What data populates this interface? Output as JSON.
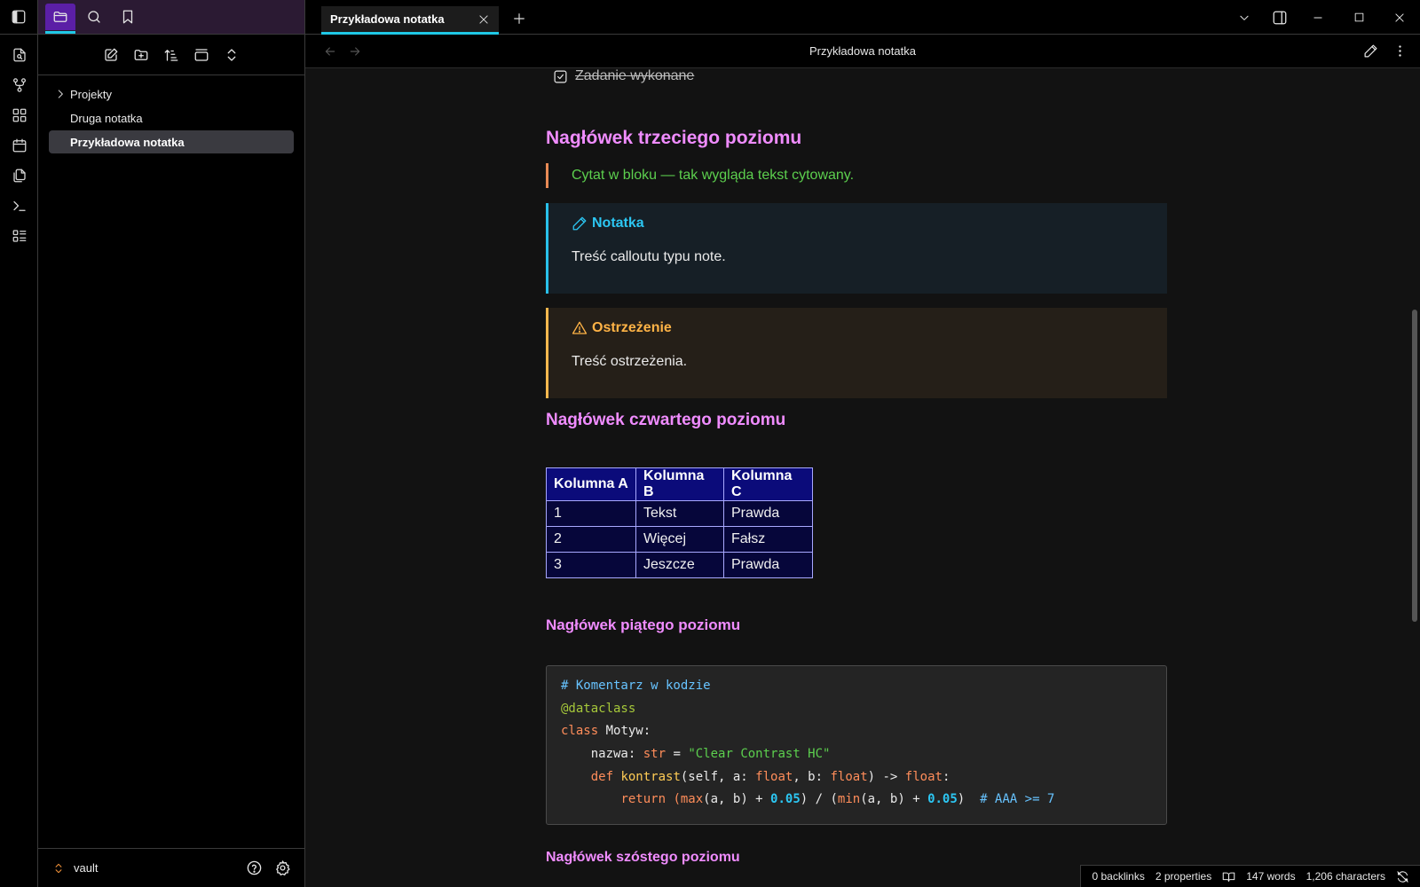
{
  "sidebar": {
    "tabs": [
      {
        "icon": "folder-icon",
        "active": true
      },
      {
        "icon": "search-icon",
        "active": false
      },
      {
        "icon": "bookmark-icon",
        "active": false
      }
    ],
    "tree": [
      {
        "label": "Projekty",
        "type": "folder",
        "collapsed": true
      },
      {
        "label": "Druga notatka",
        "type": "file"
      },
      {
        "label": "Przykładowa notatka",
        "type": "file",
        "active": true
      }
    ],
    "vault_name": "vault"
  },
  "tab": {
    "title": "Przykładowa notatka"
  },
  "view": {
    "title": "Przykładowa notatka"
  },
  "note": {
    "task": "Zadanie wykonane",
    "h3": "Nagłówek trzeciego poziomu",
    "quote": "Cytat w bloku — tak wygląda tekst cytowany.",
    "callout_note": {
      "title": "Notatka",
      "body": "Treść calloutu typu note."
    },
    "callout_warning": {
      "title": "Ostrzeżenie",
      "body": "Treść ostrzeżenia."
    },
    "h4": "Nagłówek czwartego poziomu",
    "table": {
      "headers": [
        "Kolumna A",
        "Kolumna B",
        "Kolumna C"
      ],
      "rows": [
        [
          "1",
          "Tekst",
          "Prawda"
        ],
        [
          "2",
          "Więcej",
          "Fałsz"
        ],
        [
          "3",
          "Jeszcze",
          "Prawda"
        ]
      ]
    },
    "h5": "Nagłówek piątego poziomu",
    "code": {
      "comment": "# Komentarz w kodzie",
      "decorator": "@dataclass",
      "kw_class": "class",
      "class_name": " Motyw:",
      "field": "    nazwa: ",
      "type_str": "str",
      "eq": " = ",
      "string": "\"Clear Contrast HC\"",
      "indent1": "    ",
      "kw_def": "def",
      "fn_name": " kontrast",
      "params_a": "(self, a: ",
      "type_float": "float",
      "params_b": ", b: ",
      "params_end": ") -> ",
      "colon": ":",
      "indent2": "        ",
      "kw_return": "return",
      "open": " (",
      "fn_max": "max",
      "args": "(a, b) + ",
      "num": "0.05",
      "div": ") / (",
      "fn_min": "min",
      "close": ")",
      "trail_comment": "  # AAA >= 7"
    },
    "h6": "Nagłówek szóstego poziomu"
  },
  "status": {
    "backlinks": "0 backlinks",
    "properties": "2 properties",
    "words": "147 words",
    "characters": "1,206 characters"
  },
  "colors": {
    "accent": "#1fc8e6",
    "heading": "#f08cff",
    "quote_text": "#5ccf4e",
    "note_accent": "#29c0ea",
    "warning_accent": "#f5b84e",
    "table_header_bg": "#0b0b7a"
  }
}
